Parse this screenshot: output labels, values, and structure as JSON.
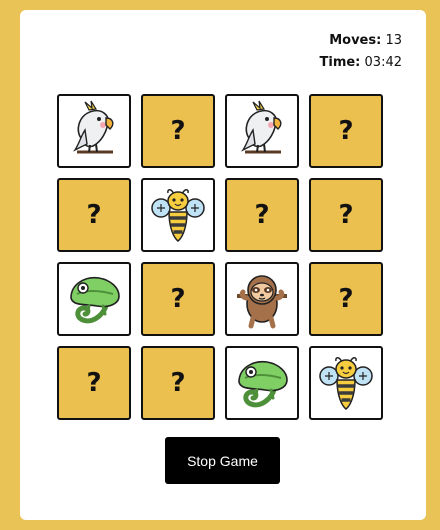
{
  "stats": {
    "moves_label": "Moves:",
    "moves_value": "13",
    "time_label": "Time:",
    "time_value": "03:42"
  },
  "cards": [
    {
      "state": "revealed",
      "animal": "cockatoo-icon"
    },
    {
      "state": "hidden",
      "label": "?"
    },
    {
      "state": "revealed",
      "animal": "cockatoo-icon"
    },
    {
      "state": "hidden",
      "label": "?"
    },
    {
      "state": "hidden",
      "label": "?"
    },
    {
      "state": "revealed",
      "animal": "bee-icon"
    },
    {
      "state": "hidden",
      "label": "?"
    },
    {
      "state": "hidden",
      "label": "?"
    },
    {
      "state": "revealed",
      "animal": "chameleon-icon"
    },
    {
      "state": "hidden",
      "label": "?"
    },
    {
      "state": "revealed",
      "animal": "sloth-icon"
    },
    {
      "state": "hidden",
      "label": "?"
    },
    {
      "state": "hidden",
      "label": "?"
    },
    {
      "state": "hidden",
      "label": "?"
    },
    {
      "state": "revealed",
      "animal": "chameleon-icon"
    },
    {
      "state": "revealed",
      "animal": "bee-icon"
    }
  ],
  "controls": {
    "stop_label": "Stop Game"
  },
  "colors": {
    "background": "#e9c356",
    "card_hidden": "#ecc04e",
    "button": "#000000"
  }
}
